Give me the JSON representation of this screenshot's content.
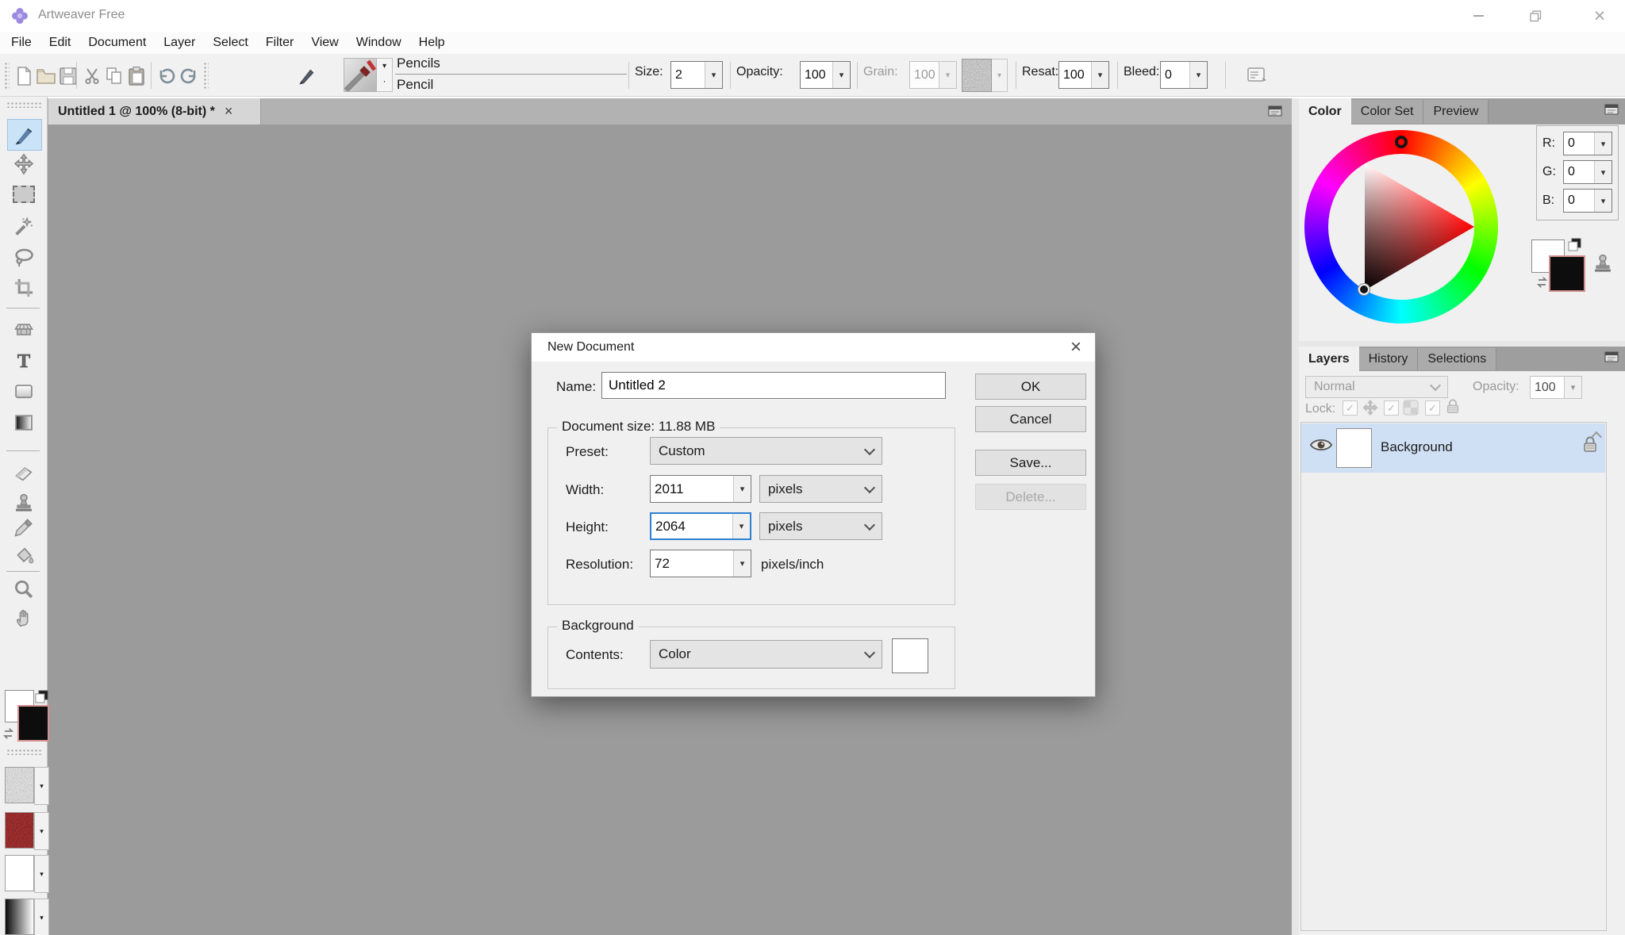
{
  "window": {
    "title": "Artweaver Free"
  },
  "menu": {
    "items": [
      "File",
      "Edit",
      "Document",
      "Layer",
      "Select",
      "Filter",
      "View",
      "Window",
      "Help"
    ]
  },
  "toolbar": {
    "brush_category": "Pencils",
    "brush_variant": "Pencil",
    "size": {
      "label": "Size:",
      "value": "2"
    },
    "opacity": {
      "label": "Opacity:",
      "value": "100"
    },
    "grain": {
      "label": "Grain:",
      "value": "100"
    },
    "resat": {
      "label": "Resat:",
      "value": "100"
    },
    "bleed": {
      "label": "Bleed:",
      "value": "0"
    }
  },
  "document_tab": {
    "title": "Untitled 1 @ 100% (8-bit) *",
    "close_glyph": "×"
  },
  "tools": [
    "brush",
    "move",
    "rect-select",
    "magic-wand",
    "lasso",
    "crop",
    "mosaic",
    "text",
    "shape",
    "gradient",
    "eraser",
    "clone-stamp",
    "eyedropper",
    "paint-bucket",
    "zoom",
    "hand"
  ],
  "dialog": {
    "title": "New Document",
    "close_glyph": "×",
    "name_label": "Name:",
    "name_value": "Untitled 2",
    "doc_size_label": "Document size:",
    "doc_size_value": "11.88 MB",
    "preset_label": "Preset:",
    "preset_value": "Custom",
    "width_label": "Width:",
    "width_value": "2011",
    "width_unit": "pixels",
    "height_label": "Height:",
    "height_value": "2064",
    "height_unit": "pixels",
    "resolution_label": "Resolution:",
    "resolution_value": "72",
    "resolution_unit": "pixels/inch",
    "background_group_label": "Background",
    "contents_label": "Contents:",
    "contents_value": "Color",
    "ok": "OK",
    "cancel": "Cancel",
    "save": "Save...",
    "delete": "Delete..."
  },
  "color_panel": {
    "tabs": [
      "Color",
      "Color Set",
      "Preview"
    ],
    "rgb": {
      "r_label": "R:",
      "r_value": "0",
      "g_label": "G:",
      "g_value": "0",
      "b_label": "B:",
      "b_value": "0"
    }
  },
  "layers_panel": {
    "tabs": [
      "Layers",
      "History",
      "Selections"
    ],
    "blend_mode": "Normal",
    "opacity_label": "Opacity:",
    "opacity_value": "100",
    "lock_label": "Lock:",
    "layer_name": "Background"
  },
  "colors": {
    "selection_blue": "#cfe0f5",
    "tool_selected": "#cbe3f7",
    "canvas_gray": "#9b9b9b",
    "fg_swatch": "#ffffff",
    "bg_swatch": "#0d0d0d",
    "focus_border": "#2f80d0"
  }
}
